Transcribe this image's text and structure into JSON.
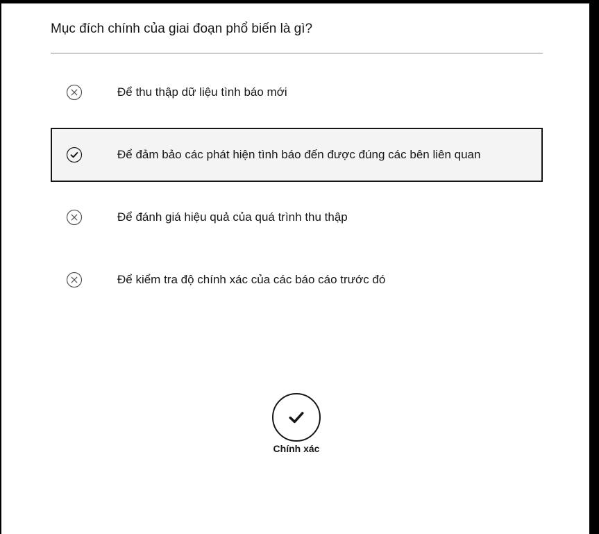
{
  "question": "Mục đích chính của giai đoạn phổ biến là gì?",
  "options": [
    {
      "label": "Để thu thập dữ liệu tình báo mới",
      "state": "incorrect",
      "icon": "x-circle-icon"
    },
    {
      "label": "Để đảm bảo các phát hiện tình báo đến được đúng các bên liên quan",
      "state": "correct-selected",
      "icon": "checkmark-circle-icon"
    },
    {
      "label": "Để đánh giá hiệu quả của quá trình thu thập",
      "state": "incorrect",
      "icon": "x-circle-icon"
    },
    {
      "label": "Để kiểm tra độ chính xác của các báo cáo trước đó",
      "state": "incorrect",
      "icon": "x-circle-icon"
    }
  ],
  "result": {
    "label": "Chính xác",
    "icon": "checkmark-icon"
  },
  "colors": {
    "text": "#161616",
    "selected_bg": "#f4f4f4",
    "divider": "#8d8d8d"
  }
}
